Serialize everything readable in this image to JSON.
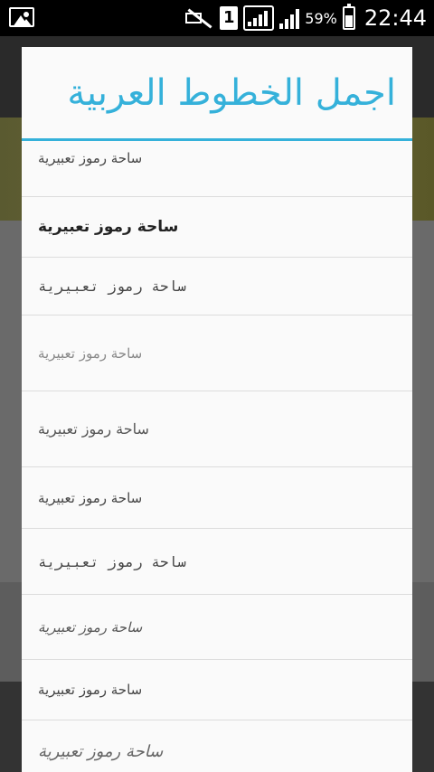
{
  "status_bar": {
    "battery_percent": "59%",
    "time": "22:44",
    "sim_slot": "1",
    "icons": [
      "gallery-icon",
      "vibrate-muted-icon",
      "sim-1-icon",
      "signal-icon",
      "signal-secondary-icon",
      "battery-icon"
    ]
  },
  "dialog": {
    "title": "اجمل الخطوط العربية",
    "items": [
      {
        "label": "ساحة رموز تعبيرية"
      },
      {
        "label": "ساحة رموز تعبيرية"
      },
      {
        "label": "ساحة رموز تعبيرية"
      },
      {
        "label": "ساحة رموز تعبيرية"
      },
      {
        "label": "ساحة رموز تعبيرية"
      },
      {
        "label": "ساحة رموز تعبيرية"
      },
      {
        "label": "ساحة رموز تعبيرية"
      },
      {
        "label": "ساحة رموز تعبيرية"
      },
      {
        "label": "ساحة رموز تعبيرية"
      },
      {
        "label": "ساحة رموز تعبيرية"
      }
    ]
  },
  "colors": {
    "accent": "#35b1da",
    "dialog_background": "#fafafa",
    "divider": "#dcdcdc",
    "status_bar": "#000000"
  }
}
